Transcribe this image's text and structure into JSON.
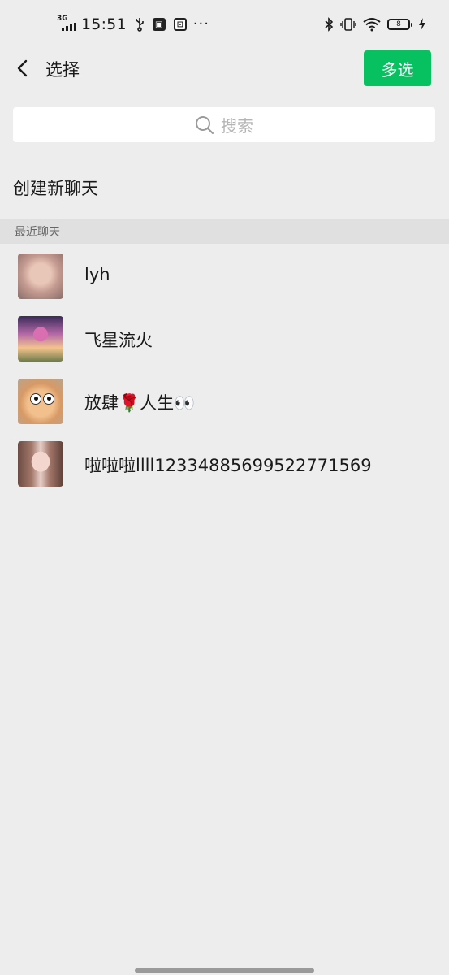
{
  "status_bar": {
    "network": "3G",
    "time": "15:51",
    "icons_left": [
      "usb-icon",
      "app-notification-icon",
      "app-notification-icon",
      "more-dots"
    ],
    "battery": "8"
  },
  "header": {
    "title": "选择",
    "multi_select_label": "多选"
  },
  "search": {
    "placeholder": "搜索"
  },
  "create_new_chat": "创建新聊天",
  "recent_section": {
    "title": "最近聊天"
  },
  "chats": [
    {
      "name": "lyh"
    },
    {
      "name": "飞星流火"
    },
    {
      "name": "放肆🌹人生👀"
    },
    {
      "name": "啦啦啦llll12334885699522771569"
    }
  ],
  "colors": {
    "background": "#ededed",
    "accent": "#07c160",
    "section_header": "#e0e0e0"
  }
}
